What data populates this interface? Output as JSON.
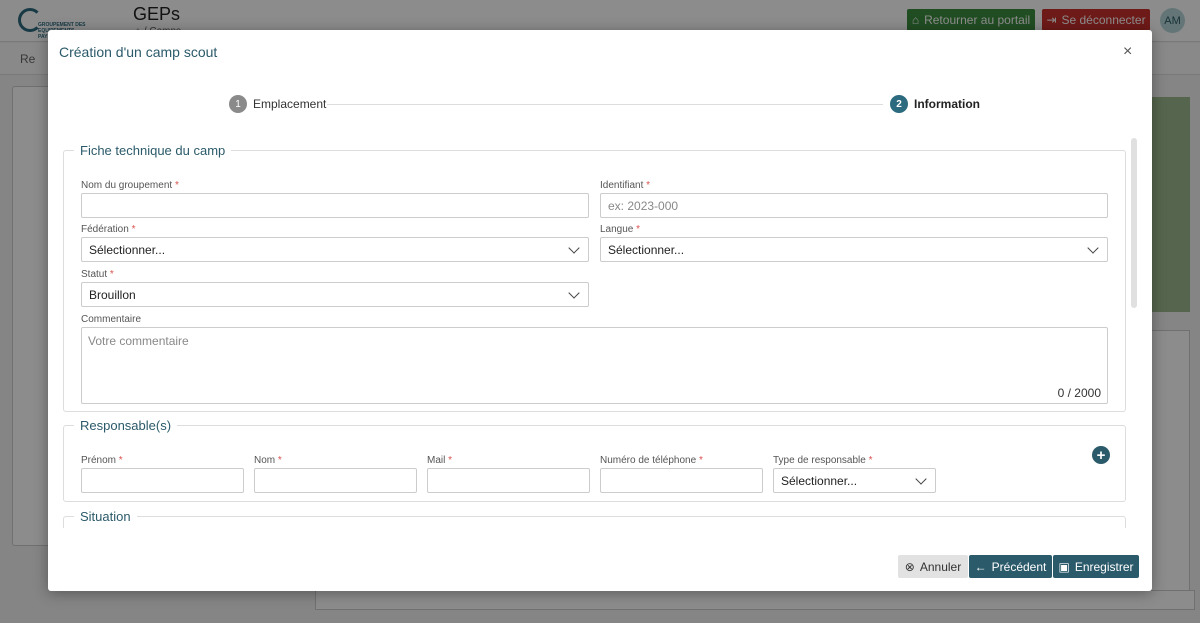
{
  "app": {
    "title": "GEPs",
    "subtitle": "⌂ / Camps",
    "portal_button": "Retourner au portail",
    "logout_button": "Se déconnecter",
    "avatar_initials": "AM",
    "search_placeholder": "Re",
    "logo_text": "GROUPEMENT DES EQUIPEMENTS PAYSAGERS",
    "colors": {
      "portal": "#3c8d3f",
      "logout": "#c9302c",
      "accent": "#2b5a6a"
    }
  },
  "modal": {
    "title": "Création d'un camp scout",
    "close_label": "×",
    "steps": [
      {
        "number": "1",
        "label": "Emplacement"
      },
      {
        "number": "2",
        "label": "Information"
      }
    ]
  },
  "fiche": {
    "legend": "Fiche technique du camp",
    "nom_groupement": {
      "label": "Nom du groupement",
      "value": ""
    },
    "identifiant": {
      "label": "Identifiant",
      "placeholder": "ex: 2023-000"
    },
    "federation": {
      "label": "Fédération",
      "value": "Sélectionner..."
    },
    "langue": {
      "label": "Langue",
      "value": "Sélectionner..."
    },
    "statut": {
      "label": "Statut",
      "value": "Brouillon"
    },
    "commentaire": {
      "label": "Commentaire",
      "placeholder": "Votre commentaire",
      "counter": "0 / 2000"
    },
    "required_mark": "*"
  },
  "responsables": {
    "legend": "Responsable(s)",
    "prenom": "Prénom",
    "nom": "Nom",
    "mail": "Mail",
    "telephone": "Numéro de téléphone",
    "type": "Type de responsable",
    "type_value": "Sélectionner...",
    "add_label": "+"
  },
  "situation": {
    "legend": "Situation"
  },
  "footer": {
    "cancel": "Annuler",
    "previous": "Précédent",
    "save": "Enregistrer"
  }
}
